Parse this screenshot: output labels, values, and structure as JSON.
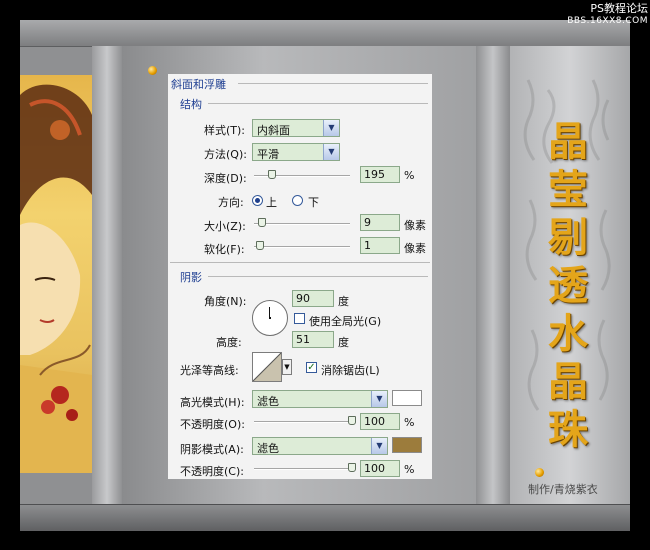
{
  "watermark": {
    "line1": "PS教程论坛",
    "line2": "BBS.16XX8.COM"
  },
  "title": {
    "chars": [
      "晶",
      "莹",
      "剔",
      "透",
      "水",
      "晶",
      "珠"
    ]
  },
  "credit": "制作/青烧紫衣",
  "dialog": {
    "header": "斜面和浮雕",
    "structure": {
      "section": "结构",
      "style_label": "样式(T):",
      "style_value": "内斜面",
      "technique_label": "方法(Q):",
      "technique_value": "平滑",
      "depth_label": "深度(D):",
      "depth_value": "195",
      "depth_unit": "%",
      "direction_label": "方向:",
      "direction_up": "上",
      "direction_down": "下",
      "direction_selected": "上",
      "size_label": "大小(Z):",
      "size_value": "9",
      "size_unit": "像素",
      "soften_label": "软化(F):",
      "soften_value": "1",
      "soften_unit": "像素"
    },
    "shading": {
      "section": "阴影",
      "angle_label": "角度(N):",
      "angle_value": "90",
      "angle_unit": "度",
      "global_light_label": "使用全局光(G)",
      "global_light_checked": false,
      "altitude_label": "高度:",
      "altitude_value": "51",
      "altitude_unit": "度",
      "gloss_label": "光泽等高线:",
      "antialias_label": "消除锯齿(L)",
      "antialias_checked": true,
      "highlight_label": "高光模式(H):",
      "highlight_value": "滤色",
      "highlight_color": "#ffffff",
      "highlight_opacity_label": "不透明度(O):",
      "highlight_opacity_value": "100",
      "highlight_opacity_unit": "%",
      "shadow_label": "阴影模式(A):",
      "shadow_value": "滤色",
      "shadow_color": "#9c7c3c",
      "shadow_opacity_label": "不透明度(C):",
      "shadow_opacity_value": "100",
      "shadow_opacity_unit": "%"
    }
  },
  "colors": {
    "accent": "#e4a51a",
    "dialog_header": "#1f3f92",
    "field_bg": "#ddecd7"
  }
}
